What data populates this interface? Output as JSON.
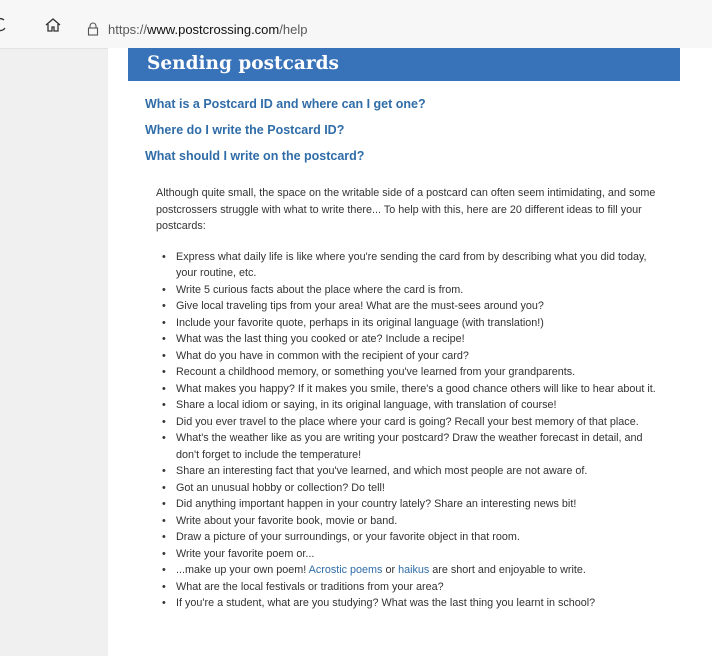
{
  "browser": {
    "url_proto": "https://",
    "url_host": "www.postcrossing.com",
    "url_path": "/help"
  },
  "section_title": "Sending postcards",
  "questions": [
    "What is a Postcard ID and where can I get one?",
    "Where do I write the Postcard ID?",
    "What should I write on the postcard?"
  ],
  "intro": "Although quite small, the space on the writable side of a postcard can often seem intimidating, and some postcrossers struggle with what to write there... To help with this, here are 20 different ideas to fill your postcards:",
  "ideas": [
    "Express what daily life is like where you're sending the card from by describing what you did today, your routine, etc.",
    "Write 5 curious facts about the place where the card is from.",
    "Give local traveling tips from your area! What are the must-sees around you?",
    "Include your favorite quote, perhaps in its original language (with translation!)",
    "What was the last thing you cooked or ate? Include a recipe!",
    "What do you have in common with the recipient of your card?",
    "Recount a childhood memory, or something you've learned from your grandparents.",
    "What makes you happy? If it makes you smile, there's a good chance others will like to hear about it.",
    "Share a local idiom or saying, in its original language, with translation of course!",
    "Did you ever travel to the place where your card is going? Recall your best memory of that place.",
    "What's the weather like as you are writing your postcard? Draw the weather forecast in detail, and don't forget to include the temperature!",
    "Share an interesting fact that you've learned, and which most people are not aware of.",
    "Got an unusual hobby or collection? Do tell!",
    "Did anything important happen in your country lately? Share an interesting news bit!",
    "Write about your favorite book, movie or band.",
    "Draw a picture of your surroundings, or your favorite object in that room.",
    "Write your favorite poem or..."
  ],
  "poem_idea": {
    "before": "...make up your own poem! ",
    "link1": "Acrostic poems",
    "middle": " or ",
    "link2": "haikus",
    "after": " are short and enjoyable to write."
  },
  "ideas_tail": [
    "What are the local festivals or traditions from your area?",
    "If you're a student, what are you studying? What was the last thing you learnt in school?"
  ],
  "icons": {
    "reload": "reload-icon",
    "home": "home-icon",
    "lock": "lock-icon"
  }
}
